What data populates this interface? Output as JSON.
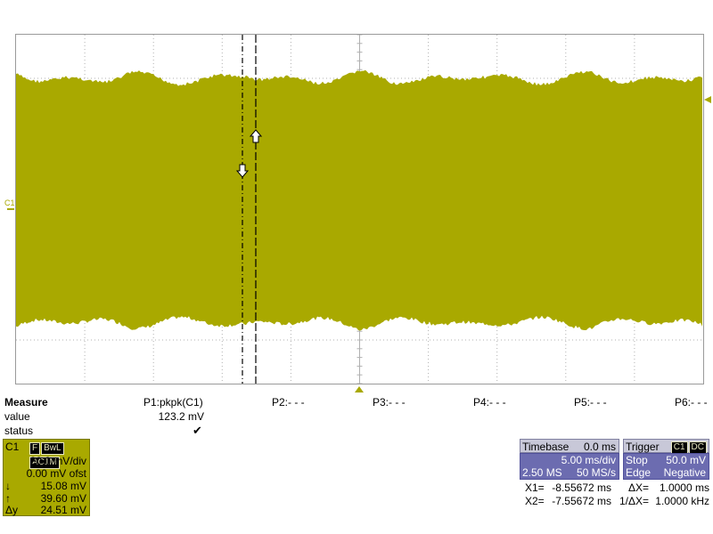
{
  "display": {
    "channel_marker": "C1",
    "colors": {
      "trace": "#a9a900",
      "grid": "#b0b0b0",
      "panel": "#6c6cb0"
    }
  },
  "measure": {
    "title": "Measure",
    "row_labels": [
      "value",
      "status"
    ],
    "params": [
      {
        "label": "P1:pkpk(C1)",
        "value": "123.2 mV",
        "status": "✔"
      },
      {
        "label": "P2:- - -"
      },
      {
        "label": "P3:- - -"
      },
      {
        "label": "P4:- - -"
      },
      {
        "label": "P5:- - -"
      },
      {
        "label": "P6:- - -"
      }
    ]
  },
  "channel": {
    "name": "C1",
    "tags": [
      "F",
      "BwL",
      "AC1M"
    ],
    "vdiv": "20.0 mV/div",
    "offset": "0.00 mV ofst",
    "cursor_down_symbol": "↓",
    "cursor_down": "15.08 mV",
    "cursor_up_symbol": "↑",
    "cursor_up": "39.60 mV",
    "delta_label": "Δy",
    "delta": "24.51 mV"
  },
  "timebase": {
    "label": "Timebase",
    "delay": "0.0 ms",
    "tdiv": "5.00 ms/div",
    "samples": "2.50 MS",
    "rate": "50 MS/s"
  },
  "trigger": {
    "label": "Trigger",
    "tags": [
      "C1",
      "DC"
    ],
    "mode": "Stop",
    "level": "50.0 mV",
    "type": "Edge",
    "slope": "Negative"
  },
  "cursors": {
    "x1_label": "X1=",
    "x1": "-8.55672 ms",
    "x2_label": "X2=",
    "x2": "-7.55672 ms",
    "dx_label": "ΔX=",
    "dx": "1.0000 ms",
    "inv_dx_label": "1/ΔX=",
    "inv_dx": "1.0000 kHz"
  }
}
